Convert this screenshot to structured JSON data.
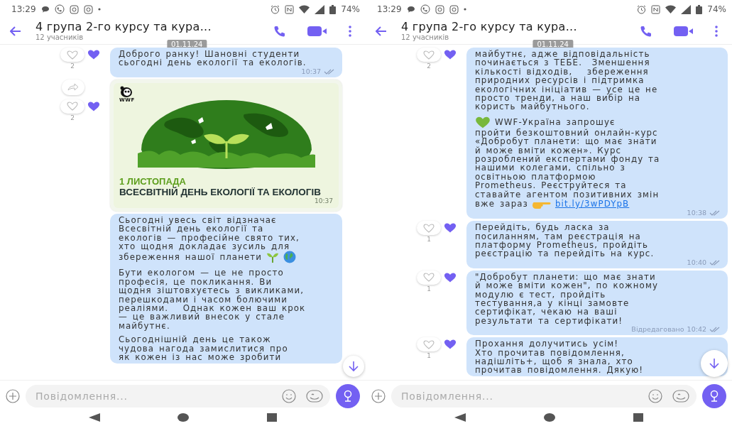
{
  "screens": [
    {
      "status_bar": {
        "time": "13:29",
        "battery": "74%"
      },
      "header": {
        "title": "4 група 2-го курсу та кура...",
        "subtitle": "12 учасників",
        "date_badge": "01.11.24"
      },
      "messages": [
        {
          "kind": "text",
          "paragraphs": [
            {
              "kind": "plain",
              "text": "Доброго ранку! Шановні студенти\nсьогодні день екології та екологів."
            }
          ],
          "time": "10:37",
          "reaction_count": "2",
          "forward": false
        },
        {
          "kind": "image",
          "image": {
            "logo_text": "WWF",
            "date_line": "1 ЛИСТОПАДА",
            "headline": "ВСЕСВІТНІЙ ДЕНЬ ЕКОЛОГІЇ ТА ЕКОЛОГІВ"
          },
          "time": "10:37",
          "reaction_count": "2",
          "forward": true
        },
        {
          "kind": "text",
          "paragraphs": [
            {
              "kind": "eco",
              "text": "Сьогодні увесь світ відзначає\nВсесвітній день екології та\nекологів — професійне свято тих,\nхто щодня докладає зусиль для",
              "tail": "збереження нашої планети"
            },
            {
              "kind": "plain",
              "text": "Бути екологом — це не просто\nпрофесія, це покликання. Ви\nщодня зіштовхуєтесь з викликами,\nперешкодами і часом болючими\nреаліями.   Однак кожен ваш крок\n— це важливий внесок у стале\nмайбутнє."
            },
            {
              "kind": "plain",
              "text": "Сьогоднішній день це також\nчудова нагода замислитися про\nяк кожен із нас може зробити"
            }
          ]
        }
      ],
      "composer": {
        "placeholder": "Повідомлення..."
      }
    },
    {
      "status_bar": {
        "time": "13:29",
        "battery": "74%"
      },
      "header": {
        "title": "4 група 2-го курсу та кура...",
        "subtitle": "12 учасників",
        "date_badge": "01.11.24"
      },
      "messages": [
        {
          "kind": "text",
          "paragraphs": [
            {
              "kind": "plain",
              "text": "майбутнє, адже відповідальність\nпочинається з ТЕБЕ.  Зменшення\nкількості відходів,   збереження\nприродних ресурсів і підтримка\nекологічних ініціатив — усе це не\nпросто тренди, а наш вибір на\nкористь майбутнього."
            },
            {
              "kind": "invite",
              "lead": "WWF-Україна запрошує",
              "text": "пройти безкоштовний онлайн-курс\n«Добробут планети: що має знати\nй може вміти кожен». Курс\nрозроблений експертами фонду та\nнашими колегами, спільно з\nосвітньою платформою\nPrometheus. Реєструйтеся та\nставайте агентом позитивних змін",
              "tail": "вже зараз",
              "link": "bit.ly/3wPDYpB"
            }
          ],
          "time": "10:38",
          "reaction_count": "2",
          "forward": false
        },
        {
          "kind": "text",
          "paragraphs": [
            {
              "kind": "plain",
              "text": "Перейдіть, будь ласка за\nпосиланням, там реєстрація на\nплатформу Prometheus, пройдіть\nреєстрацію та перейдіть на курс."
            }
          ],
          "time": "10:40",
          "reaction_count": "1",
          "forward": false
        },
        {
          "kind": "text",
          "paragraphs": [
            {
              "kind": "plain",
              "text": "\"Добробут планети: що має знати\nй може вміти кожен\", по кожному\nмодулю є тест, пройдіть\nтестування,а у кінці замовте\nсертифікат, чекаю на ваші\nрезультати та сертифікати!"
            }
          ],
          "edited_label": "Відредаговано",
          "time": "10:42",
          "reaction_count": "1",
          "forward": false
        },
        {
          "kind": "text",
          "paragraphs": [
            {
              "kind": "plain",
              "text": "Прохання долучитись усім!\nХто прочитав повідомлення,\nнадішліть+, щоб я знала, хто\nпрочитав повідомлення. Дякую!"
            }
          ],
          "reaction_count": "1",
          "forward": false
        }
      ],
      "composer": {
        "placeholder": "Повідомлення..."
      }
    }
  ]
}
